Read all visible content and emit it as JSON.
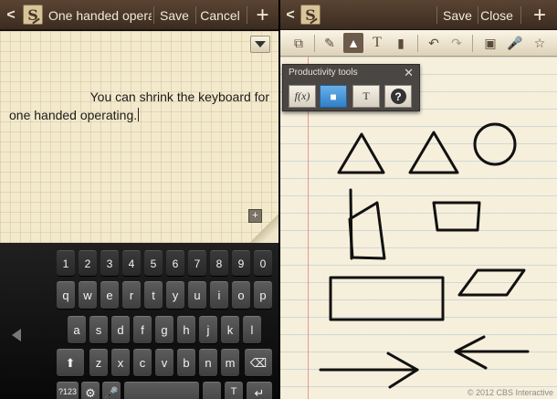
{
  "left": {
    "topbar": {
      "logo_letter": "S",
      "title": "One handed operatic",
      "save_label": "Save",
      "cancel_label": "Cancel"
    },
    "note": {
      "line1": "You can shrink the keyboard for",
      "line2": "one handed operating."
    },
    "keyboard": {
      "row_numbers": [
        "1",
        "2",
        "3",
        "4",
        "5",
        "6",
        "7",
        "8",
        "9",
        "0"
      ],
      "row_top": [
        "q",
        "w",
        "e",
        "r",
        "t",
        "y",
        "u",
        "i",
        "o",
        "p"
      ],
      "row_middle": [
        "a",
        "s",
        "d",
        "f",
        "g",
        "h",
        "j",
        "k",
        "l"
      ],
      "row_bottom": [
        "z",
        "x",
        "c",
        "v",
        "b",
        "n",
        "m"
      ],
      "symbols_label": "?123"
    }
  },
  "right": {
    "topbar": {
      "logo_letter": "S",
      "save_label": "Save",
      "close_label": "Close"
    },
    "toolbar_icons": [
      "crop-icon",
      "pen-icon",
      "shape-icon",
      "text-icon",
      "eraser-icon",
      "undo-icon",
      "redo-icon",
      "image-insert-icon",
      "microphone-icon",
      "star-icon"
    ],
    "popup": {
      "title": "Productivity tools",
      "tools": [
        "formula-icon",
        "shape-recognition-icon",
        "text-recognition-icon",
        "help-icon"
      ]
    }
  },
  "watermark": "© 2012 CBS Interactive",
  "icons": {
    "back": "back-chevron-icon",
    "add": "plus-icon",
    "dropdown": "dropdown-arrow-icon",
    "backspace": "backspace-icon",
    "shift": "shift-icon"
  }
}
